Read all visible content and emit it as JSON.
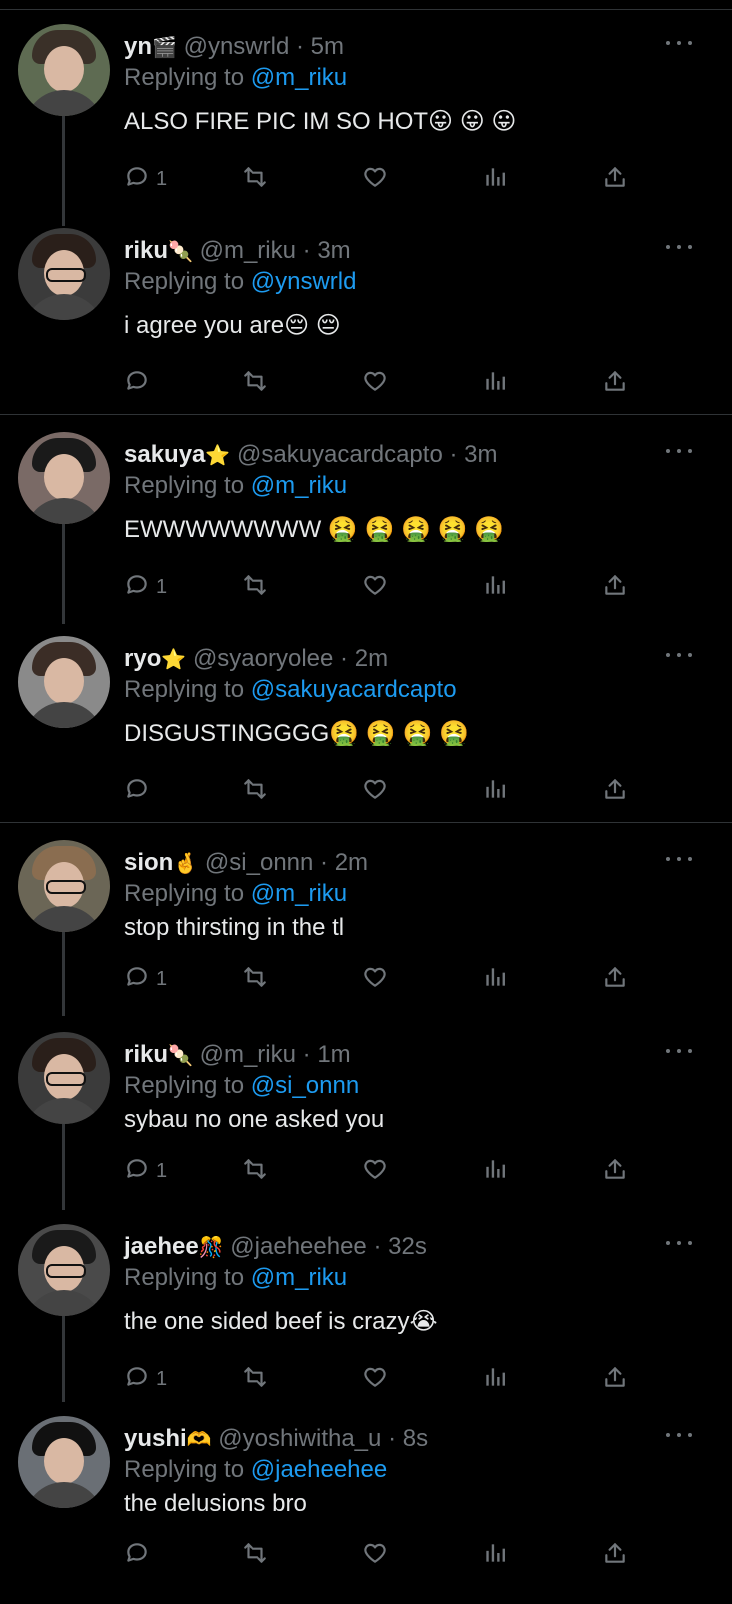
{
  "tweets": [
    {
      "name": "yn",
      "emoji": "🎬",
      "handle": "@ynswrld",
      "time": "5m",
      "replying_prefix": "Replying to",
      "replying_to": "@m_riku",
      "text": "ALSO FIRE PIC IM SO HOT😛 😛 😛",
      "reply_count": "1"
    },
    {
      "name": "riku",
      "emoji": "🍡",
      "handle": "@m_riku",
      "time": "3m",
      "replying_prefix": "Replying to",
      "replying_to": "@ynswrld",
      "text": "i agree you are😔 😔",
      "reply_count": ""
    },
    {
      "name": "sakuya",
      "emoji": "⭐",
      "handle": "@sakuyacardcapto",
      "time": "3m",
      "replying_prefix": "Replying to",
      "replying_to": "@m_riku",
      "text": "EWWWWWWWW 🤮 🤮 🤮 🤮 🤮",
      "reply_count": "1"
    },
    {
      "name": "ryo",
      "emoji": "⭐",
      "handle": "@syaoryolee",
      "time": "2m",
      "replying_prefix": "Replying to",
      "replying_to": "@sakuyacardcapto",
      "text": "DISGUSTINGGGG🤮 🤮 🤮 🤮",
      "reply_count": ""
    },
    {
      "name": "sion",
      "emoji": "🤞",
      "handle": "@si_onnn",
      "time": "2m",
      "replying_prefix": "Replying to",
      "replying_to": "@m_riku",
      "text": "stop thirsting in the tl",
      "reply_count": "1"
    },
    {
      "name": "riku",
      "emoji": "🍡",
      "handle": "@m_riku",
      "time": "1m",
      "replying_prefix": "Replying to",
      "replying_to": "@si_onnn",
      "text": "sybau no one asked you",
      "reply_count": "1"
    },
    {
      "name": "jaehee",
      "emoji": "🎊",
      "handle": "@jaeheehee",
      "time": "32s",
      "replying_prefix": "Replying to",
      "replying_to": "@m_riku",
      "text": "the one sided beef is crazy😭",
      "reply_count": "1"
    },
    {
      "name": "yushi",
      "emoji": "🫶",
      "handle": "@yoshiwitha_u",
      "time": "8s",
      "replying_prefix": "Replying to",
      "replying_to": "@jaeheehee",
      "text": "the delusions bro",
      "reply_count": ""
    }
  ],
  "icons": {
    "reply": "reply-icon",
    "retweet": "retweet-icon",
    "like": "like-icon",
    "views": "views-icon",
    "share": "share-icon",
    "more": "more-icon"
  },
  "colors": {
    "background": "#000000",
    "text": "#e7e9ea",
    "muted": "#71767b",
    "link": "#1d9bf0",
    "divider": "#2f3336"
  }
}
